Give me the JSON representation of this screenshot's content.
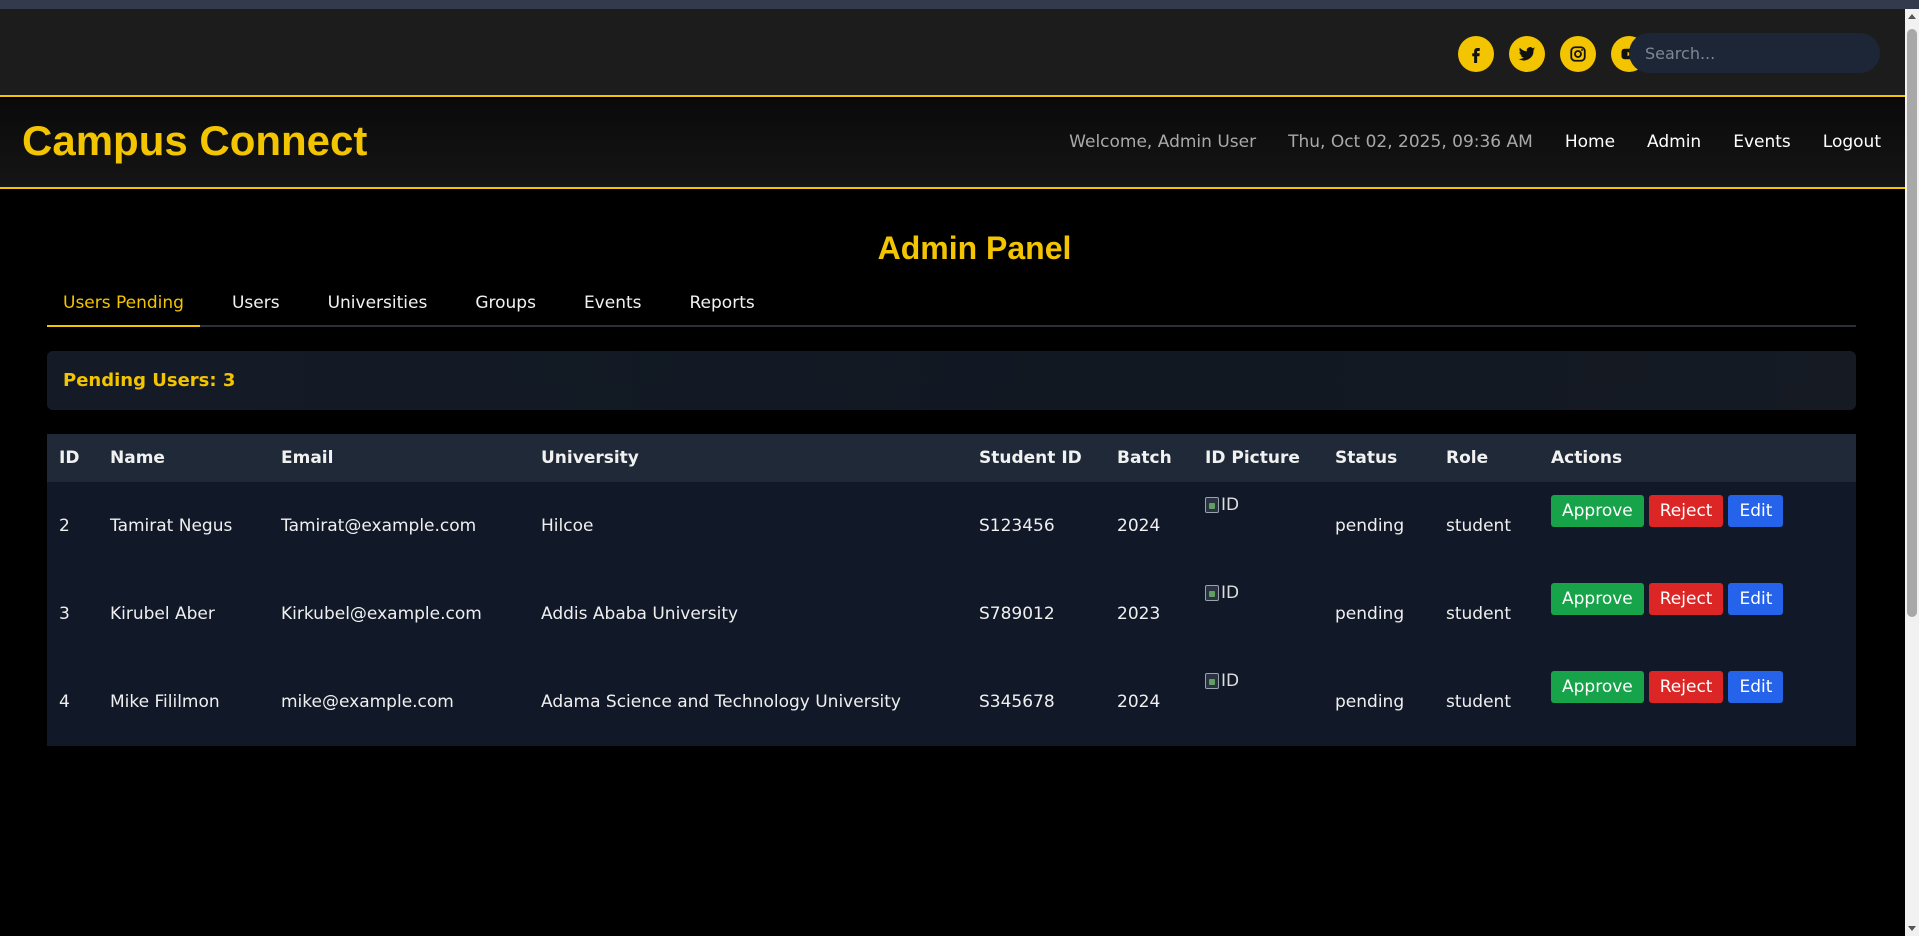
{
  "topbar": {
    "social_icons": [
      "facebook-icon",
      "twitter-icon",
      "instagram-icon",
      "youtube-icon"
    ],
    "search_placeholder": "Search..."
  },
  "header": {
    "brand": "Campus Connect",
    "welcome": "Welcome, Admin User",
    "datetime": "Thu, Oct 02, 2025, 09:36 AM",
    "nav": [
      "Home",
      "Admin",
      "Events",
      "Logout"
    ]
  },
  "panel": {
    "title": "Admin Panel",
    "tabs": [
      "Users Pending",
      "Users",
      "Universities",
      "Groups",
      "Events",
      "Reports"
    ],
    "active_tab": "Users Pending",
    "pending_summary": "Pending Users: 3",
    "columns": [
      "ID",
      "Name",
      "Email",
      "University",
      "Student ID",
      "Batch",
      "ID Picture",
      "Status",
      "Role",
      "Actions"
    ],
    "rows": [
      {
        "id": "2",
        "name": "Tamirat Negus",
        "email": "Tamirat@example.com",
        "university": "Hilcoe",
        "student_id": "S123456",
        "batch": "2024",
        "id_picture_alt": "ID",
        "status": "pending",
        "role": "student"
      },
      {
        "id": "3",
        "name": "Kirubel Aber",
        "email": "Kirkubel@example.com",
        "university": "Addis Ababa University",
        "student_id": "S789012",
        "batch": "2023",
        "id_picture_alt": "ID",
        "status": "pending",
        "role": "student"
      },
      {
        "id": "4",
        "name": "Mike Fililmon",
        "email": "mike@example.com",
        "university": "Adama Science and Technology University",
        "student_id": "S345678",
        "batch": "2024",
        "id_picture_alt": "ID",
        "status": "pending",
        "role": "student"
      }
    ],
    "actions": {
      "approve": "Approve",
      "reject": "Reject",
      "edit": "Edit"
    }
  },
  "colors": {
    "accent": "#f3c400",
    "approve": "#16a34a",
    "reject": "#dc2626",
    "edit": "#2563eb"
  }
}
